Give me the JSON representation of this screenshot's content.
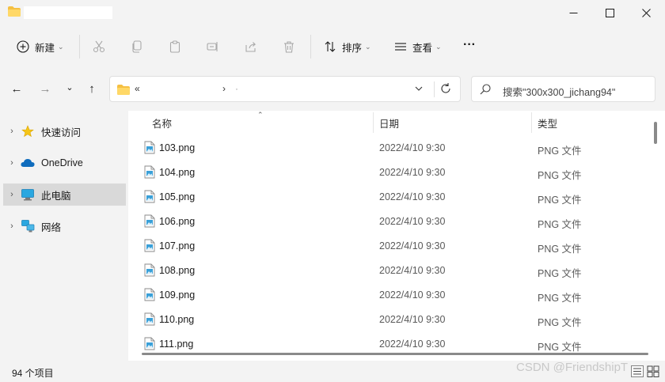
{
  "titlebar": {
    "title": ""
  },
  "toolbar": {
    "new_label": "新建",
    "sort_label": "排序",
    "view_label": "查看",
    "more_label": "···"
  },
  "nav": {
    "back": "←",
    "forward": "→",
    "recent": "⌄",
    "up": "↑",
    "address_prefix": "«",
    "address_separator": "›",
    "address_trail": "·",
    "search_placeholder": "搜索\"300x300_jichang94\""
  },
  "sidebar": {
    "items": [
      {
        "label": "快速访问",
        "icon": "star-icon"
      },
      {
        "label": "OneDrive",
        "icon": "cloud-icon"
      },
      {
        "label": "此电脑",
        "icon": "computer-icon",
        "selected": true
      },
      {
        "label": "网络",
        "icon": "network-icon"
      }
    ]
  },
  "list": {
    "columns": {
      "name": "名称",
      "date": "日期",
      "type": "类型"
    },
    "sort_indicator": "⌃",
    "rows": [
      {
        "name": "103.png",
        "date": "2022/4/10 9:30",
        "type": "PNG 文件"
      },
      {
        "name": "104.png",
        "date": "2022/4/10 9:30",
        "type": "PNG 文件"
      },
      {
        "name": "105.png",
        "date": "2022/4/10 9:30",
        "type": "PNG 文件"
      },
      {
        "name": "106.png",
        "date": "2022/4/10 9:30",
        "type": "PNG 文件"
      },
      {
        "name": "107.png",
        "date": "2022/4/10 9:30",
        "type": "PNG 文件"
      },
      {
        "name": "108.png",
        "date": "2022/4/10 9:30",
        "type": "PNG 文件"
      },
      {
        "name": "109.png",
        "date": "2022/4/10 9:30",
        "type": "PNG 文件"
      },
      {
        "name": "110.png",
        "date": "2022/4/10 9:30",
        "type": "PNG 文件"
      },
      {
        "name": "111.png",
        "date": "2022/4/10 9:30",
        "type": "PNG 文件"
      }
    ]
  },
  "status": {
    "item_count": "94 个项目",
    "watermark": "CSDN @FriendshipT"
  },
  "colors": {
    "folder": "#f5c042",
    "accent": "#0067c0",
    "selected_bg": "#d9d9d9"
  }
}
